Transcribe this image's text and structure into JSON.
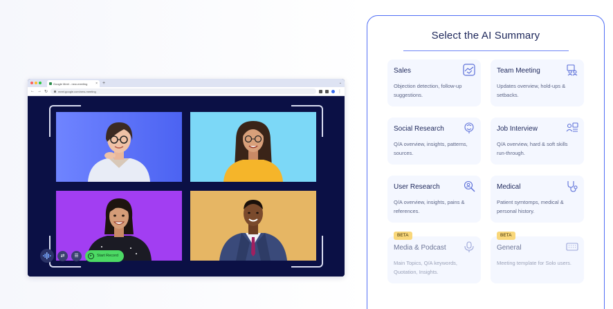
{
  "browser": {
    "tab_label": "Google Meet - new-meeting",
    "tab_close": "×",
    "tab_new": "+",
    "tab_chevron": "⌄",
    "url": "meet.google.com/new-meeting",
    "traffic_lights": [
      "#ff5f57",
      "#febc2e",
      "#28c840"
    ]
  },
  "controls": {
    "record_label": "Start Record"
  },
  "summary": {
    "title": "Select the AI Summary",
    "accent": "#4f6df5",
    "cards": [
      {
        "title": "Sales",
        "desc": "Objection detection, follow-up suggestions.",
        "icon": "handshake-icon"
      },
      {
        "title": "Team Meeting",
        "desc": "Updates overview, hold-ups & setbacks.",
        "icon": "team-icon"
      },
      {
        "title": "Social Research",
        "desc": "Q/A overview, insights, patterns, sources.",
        "icon": "brain-icon"
      },
      {
        "title": "Job Interview",
        "desc": "Q/A overview, hard & soft skills run-through.",
        "icon": "interview-icon"
      },
      {
        "title": "User Research",
        "desc": "Q/A overview, insights, pains & references.",
        "icon": "user-search-icon"
      },
      {
        "title": "Medical",
        "desc": "Patient symtomps, medical & personal history.",
        "icon": "stethoscope-icon"
      },
      {
        "title": "Media & Podcast",
        "desc": "Main Topics, Q/A keywords, Quotation, Insights.",
        "icon": "microphone-icon",
        "badge": "BETA"
      },
      {
        "title": "General",
        "desc": "Meeting template for Solo users.",
        "icon": "keyboard-icon",
        "badge": "BETA"
      }
    ]
  }
}
